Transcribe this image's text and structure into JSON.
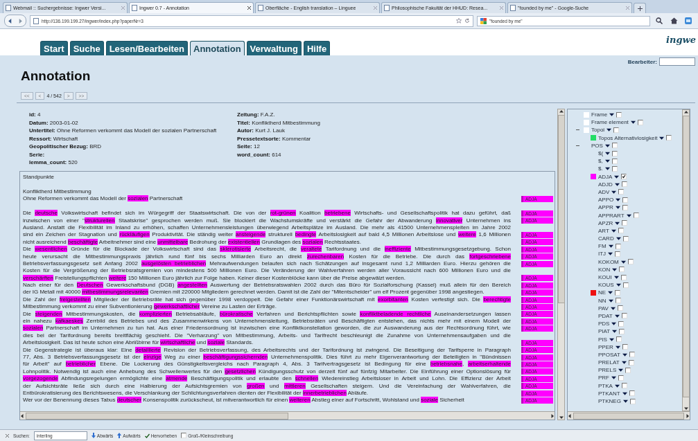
{
  "browser": {
    "tabs": [
      {
        "title": "Webmail :: Suchergebnisse: Ingwer Versi...",
        "selected": false
      },
      {
        "title": "Ingwer 0.7 - Annotation",
        "selected": true
      },
      {
        "title": "Oberfläche - English translation – Linguee",
        "selected": false
      },
      {
        "title": "Philosophische Fakultät der HHUD: Resea...",
        "selected": false
      },
      {
        "title": "\"founded by me\" - Google-Suche",
        "selected": false
      }
    ],
    "url": "http://136.199.199.27/ingwer/index.php?paperNr=3",
    "search": "\"founded by me\""
  },
  "app": {
    "tabs": [
      {
        "label": "Start",
        "selected": false
      },
      {
        "label": "Suche",
        "selected": false
      },
      {
        "label": "Lesen/Bearbeiten",
        "selected": false
      },
      {
        "label": "Annotation",
        "selected": true
      },
      {
        "label": "Verwaltung",
        "selected": false
      },
      {
        "label": "Hilfe",
        "selected": false
      }
    ],
    "logo": "ingwe",
    "editor_label": "Bearbeiter:"
  },
  "heading": "Annotation",
  "pager": {
    "prev_buttons": [
      "<<",
      "<"
    ],
    "position": "4 / 542",
    "next_buttons": [
      ">",
      ">>"
    ]
  },
  "metadata": {
    "left": [
      {
        "label": "id:",
        "value": "4"
      },
      {
        "label": "Datum:",
        "value": "2003-01-02"
      },
      {
        "label": "Untertitel:",
        "value": "Ohne Reformen verkommt das Modell der sozialen Partnerschaft"
      },
      {
        "label": "Ressort:",
        "value": "Wirtschaft"
      },
      {
        "label": "Geopolitischer Bezug:",
        "value": "BRD"
      },
      {
        "label": "Serie:"
      },
      {
        "label": "lemma_count:",
        "value": "520"
      }
    ],
    "right": [
      {
        "label": "Zeitung:",
        "value": "F.A.Z."
      },
      {
        "label": "Titel:",
        "value": "Konfliktherd Mitbestimmung"
      },
      {
        "label": "Autor:",
        "value": "Kurt J. Lauk"
      },
      {
        "label": "Pressetextsorte:",
        "value": "Kommentar"
      },
      {
        "label": "Seite:",
        "value": "12"
      },
      {
        "label": "word_count:",
        "value": "614"
      }
    ]
  },
  "document": {
    "blocks": [
      {
        "kind": "heading",
        "lines": [
          {
            "segments": [
              {
                "text": "Standpunkte",
                "highlighted": false
              }
            ]
          }
        ]
      },
      {
        "kind": "title",
        "lines": [
          {
            "segments": [
              {
                "text": "Konfliktherd Mitbestimmung",
                "highlighted": false
              }
            ]
          },
          {
            "segments": [
              {
                "text": "Ohne Reformen verkommt das Modell der ",
                "highlighted": false
              },
              {
                "text": "sozialen",
                "highlighted": true
              },
              {
                "text": " Partnerschaft",
                "highlighted": false
              }
            ],
            "tag": "ADJA"
          }
        ]
      },
      {
        "kind": "body",
        "lines": [
          {
            "segments": [
              {
                "text": "Die ",
                "highlighted": false
              },
              {
                "text": "deutsche",
                "highlighted": true
              },
              {
                "text": " Volkswirtschaft befindet sich im Würgegriff der Staatswirtschaft. Die von der ",
                "highlighted": false
              },
              {
                "text": "rot-grünen",
                "highlighted": true
              },
              {
                "text": " Koalition ",
                "highlighted": false
              },
              {
                "text": "betriebene",
                "highlighted": true
              },
              {
                "text": " Wirtschafts- und Gesellschaftspolitik hat dazu geführt, daß",
                "highlighted": false
              }
            ],
            "tag": "ADJA"
          },
          {
            "segments": [
              {
                "text": "inzwischen von einer \"",
                "highlighted": false
              },
              {
                "text": "strukturellen",
                "highlighted": true
              },
              {
                "text": " Staatskrise\" gesprochen werden muß. Sie blockiert die Wachstumskräfte und verstärkt die Gefahr der Abwanderung ",
                "highlighted": false
              },
              {
                "text": "innovativer",
                "highlighted": true
              },
              {
                "text": " Unternehmen ins",
                "highlighted": false
              }
            ],
            "tag": "ADJA"
          },
          {
            "segments": [
              {
                "text": "Ausland. Anstatt die Flexibilität im Inland zu erhöhen, schaffen Unternehmensleistungen überwiegend Arbeitsplätze im Ausland. Die mehr als 41500 Unternehmenspleiten im Jahre 2002",
                "highlighted": false
              }
            ]
          },
          {
            "segments": [
              {
                "text": "sind ein Zeichen der Stagnation und ",
                "highlighted": false
              },
              {
                "text": "rückläufigen",
                "highlighted": true
              },
              {
                "text": " Produktivität. Die ständig weiter ",
                "highlighted": false
              },
              {
                "text": "ansteigende",
                "highlighted": true
              },
              {
                "text": " strukturell ",
                "highlighted": false
              },
              {
                "text": "bedingte",
                "highlighted": true
              },
              {
                "text": " Arbeitslosigkeit auf bald 4,5 Millionen Arbeitslose und ",
                "highlighted": false
              },
              {
                "text": "weitere",
                "highlighted": true
              },
              {
                "text": " 1,6 Millionen",
                "highlighted": false
              }
            ],
            "tag": "ADJA"
          },
          {
            "segments": [
              {
                "text": "nicht ausreichend ",
                "highlighted": false
              },
              {
                "text": "beschäftigte",
                "highlighted": true
              },
              {
                "text": " Arbeitnehmer sind eine ",
                "highlighted": false
              },
              {
                "text": "unmittelbare",
                "highlighted": true
              },
              {
                "text": " Bedrohung der ",
                "highlighted": false
              },
              {
                "text": "existentiellen",
                "highlighted": true
              },
              {
                "text": " Grundlagen des ",
                "highlighted": false
              },
              {
                "text": "sozialen",
                "highlighted": true
              },
              {
                "text": " Rechtsstaates.",
                "highlighted": false
              }
            ],
            "tag": "ADJA"
          }
        ]
      },
      {
        "kind": "body",
        "lines": [
          {
            "segments": [
              {
                "text": "Die ",
                "highlighted": false
              },
              {
                "text": "wesentlichen",
                "highlighted": true
              },
              {
                "text": " Gründe für die Blockade der Volkswirtschaft sind das ",
                "highlighted": false
              },
              {
                "text": "sklerotisierte",
                "highlighted": true
              },
              {
                "text": " Arbeitsrecht, die ",
                "highlighted": false
              },
              {
                "text": "veraltete",
                "highlighted": true
              },
              {
                "text": " Tarifordnung und die ",
                "highlighted": false
              },
              {
                "text": "ineffiziente",
                "highlighted": true
              },
              {
                "text": " Mitbestimmungsgesetzgebung. Schon",
                "highlighted": false
              }
            ],
            "tag": "ADJA"
          },
          {
            "segments": [
              {
                "text": "heute verursacht die Mitbestimmungspraxis jährlich rund fünf bis sechs Milliarden Euro an direkt ",
                "highlighted": false
              },
              {
                "text": "zurechenbaren",
                "highlighted": true
              },
              {
                "text": " Kosten für die Betriebe. Die durch das ",
                "highlighted": false
              },
              {
                "text": "fortgeschriebene",
                "highlighted": true
              }
            ],
            "tag": "ADJA"
          },
          {
            "segments": [
              {
                "text": "Betriebsverfassungsgesetz seit Anfang 2002 ",
                "highlighted": false
              },
              {
                "text": "ausgelösten ",
                "highlighted": true
              },
              {
                "text": "betrieblichen",
                "highlighted": true
              },
              {
                "text": " Mehraufwendungen belaufen sich nach Schätzungen auf insgesamt rund 1,2 Milliarden Euro. Hierzu gehören die",
                "highlighted": false
              }
            ],
            "tag": "ADJA"
          },
          {
            "segments": [
              {
                "text": "Kosten für die Vergrößerung der Betriebsratsgremien von mindestens 500 Millionen Euro. Die Veränderung der Wahlverfahren werden aller Voraussicht nach 600 Millionen Euro und die",
                "highlighted": false
              }
            ]
          },
          {
            "segments": [
              {
                "text": "verschärften",
                "highlighted": true
              },
              {
                "text": " Freistellungspflichten ",
                "highlighted": false
              },
              {
                "text": "weitere",
                "highlighted": true
              },
              {
                "text": " 150 Millionen Euro jährlich zur Folge haben. Keiner dieser Kostenblöcke kann über die Preise abgewälzt werden.",
                "highlighted": false
              }
            ],
            "tag": "ADJA"
          }
        ]
      },
      {
        "kind": "body",
        "lines": [
          {
            "segments": [
              {
                "text": "Nach einer für den ",
                "highlighted": false
              },
              {
                "text": "Deutschen",
                "highlighted": true
              },
              {
                "text": " Gewerkschaftsbund (DGB) ",
                "highlighted": false
              },
              {
                "text": "angestellten",
                "highlighted": true
              },
              {
                "text": " Auswertung der Betriebsratswahlen 2002 durch das Büro für Sozialforschung (Kassel) muß allein für den Bereich",
                "highlighted": false
              }
            ],
            "tag": "ADJA"
          },
          {
            "segments": [
              {
                "text": "der IG Metall mit 40000 ",
                "highlighted": false
              },
              {
                "text": "mitbestimmungsrelevanten",
                "highlighted": true
              },
              {
                "text": " Gremien mit 220000 Mitgliedern gerechnet werden. Damit ist die Zahl der \"Mitentscheider\" um elf Prozent gegenüber 1998 angestiegen.",
                "highlighted": false
              }
            ],
            "tag": "ADJA"
          }
        ]
      },
      {
        "kind": "body",
        "lines": [
          {
            "segments": [
              {
                "text": "Die Zahl der ",
                "highlighted": false
              },
              {
                "text": "freigestellten",
                "highlighted": true
              },
              {
                "text": " Mitglieder der Betriebsräte hat sich gegenüber 1998 verdoppelt. Die Gefahr einer Funktionärswirtschaft mit ",
                "highlighted": false
              },
              {
                "text": "exorbitanten",
                "highlighted": true
              },
              {
                "text": " Kosten verfestigt sich. Die ",
                "highlighted": false
              },
              {
                "text": "berechtigte",
                "highlighted": true
              }
            ],
            "tag": "ADJA"
          },
          {
            "segments": [
              {
                "text": "Mitbestimmung verkommt zu einer Subventionierung ",
                "highlighted": false
              },
              {
                "text": "gewerkschaftlicher",
                "highlighted": true
              },
              {
                "text": " Vereine zu Lasten der Erträge.",
                "highlighted": false
              }
            ],
            "tag": "ADJA"
          }
        ]
      },
      {
        "kind": "body",
        "lines": [
          {
            "segments": [
              {
                "text": "Die ",
                "highlighted": false
              },
              {
                "text": "steigenden",
                "highlighted": true
              },
              {
                "text": " Mitbestimmungskosten, die ",
                "highlighted": false
              },
              {
                "text": "komplizierten",
                "highlighted": true
              },
              {
                "text": " Betriebsabläufe, ",
                "highlighted": false
              },
              {
                "text": "bürokratische",
                "highlighted": true
              },
              {
                "text": " Verfahren und Berichtspflichten sowie ",
                "highlighted": false
              },
              {
                "text": "konfliktbeladende ",
                "highlighted": true
              },
              {
                "text": "rechtliche",
                "highlighted": true
              },
              {
                "text": " Auseinandersetzungen lassen",
                "highlighted": false
              }
            ],
            "tag": "ADJA"
          },
          {
            "segments": [
              {
                "text": "ein nahezu ",
                "highlighted": false
              },
              {
                "text": "kafkaeskes",
                "highlighted": true
              },
              {
                "text": " Zerrbild des Betriebes und des Zusammenwirkens von Unternehmensleitung, Betriebsräten und Beschäftigten entstehen, das nichts mehr mit einem Modell der",
                "highlighted": false
              }
            ],
            "tag": "ADJA"
          },
          {
            "segments": [
              {
                "text": "sozialen",
                "highlighted": true
              },
              {
                "text": " Partnerschaft im Unternehmen zu tun hat. Aus einer Friedensordnung ist inzwischen eine Konfliktkonstellation geworden, die zur Auswanderung aus der Rechtsordnung führt, wie",
                "highlighted": false
              }
            ],
            "tag": "ADJA"
          },
          {
            "segments": [
              {
                "text": "dies bei der Tarifordnung bereits breitflächig geschieht. Die \"Verharzung\" von Mitbestimmung, Arbeits- und Tarifrecht beschleunigt die Zunahme von Unternehmensaufgaben und die",
                "highlighted": false
              }
            ]
          },
          {
            "segments": [
              {
                "text": "Arbeitslosigkeit. Das ist heute schon eine Abrißbirne für ",
                "highlighted": false
              },
              {
                "text": "wirtschaftliche",
                "highlighted": true
              },
              {
                "text": " und ",
                "highlighted": false
              },
              {
                "text": "soziale",
                "highlighted": true
              },
              {
                "text": " Standards.",
                "highlighted": false
              }
            ],
            "tag": "ADJA"
          }
        ]
      },
      {
        "kind": "body",
        "lines": [
          {
            "segments": [
              {
                "text": "Die Gegenstrategie ist überaus klar: Eine ",
                "highlighted": false
              },
              {
                "text": "detaillierte",
                "highlighted": true
              },
              {
                "text": " Revision der Betriebsverfassung, des Arbeitsrechts und der Tarifordnung ist zwingend. Die Beseitigung der Tarifsperre in Paragraph",
                "highlighted": false
              }
            ],
            "tag": "ADJA"
          },
          {
            "segments": [
              {
                "text": "77, Abs. 3 Betriebsverfassungsgesetz ist der ",
                "highlighted": false
              },
              {
                "text": "einzige",
                "highlighted": true
              },
              {
                "text": " Weg zu einer ",
                "highlighted": false
              },
              {
                "text": "beschäftigungssichernden",
                "highlighted": true
              },
              {
                "text": " Unternehmenspolitik. Dies führt zu mehr Eigenverantwortung der Beteiligten in \"Bündnissen",
                "highlighted": false
              }
            ],
            "tag": "ADJA"
          },
          {
            "segments": [
              {
                "text": "für Arbeit\" auf ",
                "highlighted": false
              },
              {
                "text": "betrieblicher",
                "highlighted": true
              },
              {
                "text": " Ebene. Die Lockerung des Günstigkeitsvergleichs nach Paragraph 4, Abs. 3 Tarifvertragsgesetz ist Bedingung für eine ",
                "highlighted": false
              },
              {
                "text": "betriebsnahe",
                "highlighted": true
              },
              {
                "text": ", ",
                "highlighted": false
              },
              {
                "text": "arbeitserhaltende",
                "highlighted": true
              }
            ],
            "tag": "ADJA"
          },
          {
            "segments": [
              {
                "text": "Lohnpolitik. Notwendig ist auch eine Anhebung des Schwellenwertes für den ",
                "highlighted": false
              },
              {
                "text": "gesetzlichen",
                "highlighted": true
              },
              {
                "text": " Kündigungsschutz von derzeit fünf auf fünfzig Mitarbeiter. Die Einführung einer Optionslösung für",
                "highlighted": false
              }
            ],
            "tag": "ADJA"
          },
          {
            "segments": [
              {
                "text": "vorgezogende",
                "highlighted": true
              },
              {
                "text": " Abfindungsregelungen ermöglichte eine ",
                "highlighted": false
              },
              {
                "text": "atmende",
                "highlighted": true
              },
              {
                "text": " Beschäftigungspolitik und erlaubte den ",
                "highlighted": false
              },
              {
                "text": "schnellen",
                "highlighted": true
              },
              {
                "text": " Wiedereinstieg Arbeitsloser in Arbeit und Lohn. Die Effizienz der Arbeit",
                "highlighted": false
              }
            ],
            "tag": "ADJA"
          },
          {
            "segments": [
              {
                "text": "der Aufsichtsräte ließe sich durch eine Halbierung der Aufsichtsgremien von ",
                "highlighted": false
              },
              {
                "text": "großen",
                "highlighted": true
              },
              {
                "text": " und ",
                "highlighted": false
              },
              {
                "text": "mittleren",
                "highlighted": true
              },
              {
                "text": " Gesellschaften steigern. Und die Vereinfachung der Wahlverfahren, die",
                "highlighted": false
              }
            ],
            "tag": "ADJA"
          },
          {
            "segments": [
              {
                "text": "Entbürokratisierung des Berichtswesens, die Verschlankung der Schlichtungsverfahren dienten der Flexibilität der ",
                "highlighted": false
              },
              {
                "text": "innerbetrieblichen",
                "highlighted": true
              },
              {
                "text": " Abläufe.",
                "highlighted": false
              }
            ],
            "tag": "ADJA"
          }
        ]
      },
      {
        "kind": "body",
        "lines": [
          {
            "segments": [
              {
                "text": "Wer vor der Benennung dieses Tabus ",
                "highlighted": false
              },
              {
                "text": "deutscher",
                "highlighted": true
              },
              {
                "text": " Konsenspolitik zurückscheut, ist mitverantwortlich für einen ",
                "highlighted": false
              },
              {
                "text": "weiteren",
                "highlighted": true
              },
              {
                "text": " Abstieg einer auf Fortschritt, Wohlstand und ",
                "highlighted": false
              },
              {
                "text": "soziale",
                "highlighted": true
              },
              {
                "text": " Sicherheit",
                "highlighted": false
              }
            ],
            "tag": "ADJA"
          }
        ]
      }
    ]
  },
  "sidebar": {
    "items": [
      {
        "label": "Frame",
        "color": "#ffffff",
        "checked": false
      },
      {
        "label": "Frame element",
        "color": "#ffffff",
        "checked": false
      },
      {
        "label": "Topoi",
        "color": "#ffffff",
        "checked": false,
        "expanded": true,
        "children": [
          {
            "label": "Topos Alternativlosigkeit",
            "color": "#22dd66",
            "checked": false
          }
        ]
      },
      {
        "label": "POS",
        "checked": false,
        "expanded": true,
        "children": [
          {
            "label": "$(",
            "checked": false
          },
          {
            "label": "$,",
            "checked": false
          },
          {
            "label": "$.",
            "checked": false
          },
          {
            "label": "ADJA",
            "color": "#ff00ff",
            "checked": true
          },
          {
            "label": "ADJD",
            "checked": false
          },
          {
            "label": "ADV",
            "checked": false
          },
          {
            "label": "APPO",
            "checked": false
          },
          {
            "label": "APPR",
            "checked": false
          },
          {
            "label": "APPRART",
            "checked": false
          },
          {
            "label": "APZR",
            "checked": false
          },
          {
            "label": "ART",
            "checked": false
          },
          {
            "label": "CARD",
            "checked": false
          },
          {
            "label": "FM",
            "checked": false
          },
          {
            "label": "ITJ",
            "checked": false
          },
          {
            "label": "KOKOM",
            "checked": false
          },
          {
            "label": "KON",
            "checked": false
          },
          {
            "label": "KOUI",
            "checked": false
          },
          {
            "label": "KOUS",
            "checked": false
          },
          {
            "label": "NE",
            "color": "#ee1111",
            "checked": false
          },
          {
            "label": "NN",
            "checked": false
          },
          {
            "label": "PAV",
            "checked": false
          },
          {
            "label": "PDAT",
            "checked": false
          },
          {
            "label": "PDS",
            "checked": false
          },
          {
            "label": "PIAT",
            "checked": false
          },
          {
            "label": "PIS",
            "checked": false
          },
          {
            "label": "PPER",
            "checked": false
          },
          {
            "label": "PPOSAT",
            "checked": false
          },
          {
            "label": "PRELAT",
            "checked": false
          },
          {
            "label": "PRELS",
            "checked": false
          },
          {
            "label": "PRF",
            "checked": false
          },
          {
            "label": "PTKA",
            "checked": false
          },
          {
            "label": "PTKANT",
            "checked": false
          },
          {
            "label": "PTKNEG",
            "checked": false
          }
        ]
      }
    ]
  },
  "find_bar": {
    "label": "Suchen:",
    "value": "interling",
    "buttons": [
      {
        "label": "Abwärts",
        "kind": "down"
      },
      {
        "label": "Aufwärts",
        "kind": "up"
      }
    ],
    "highlight": {
      "label": "Hervorheben",
      "checked": true
    },
    "match_case": {
      "label": "Groß-/Kleinschreibung",
      "checked": false
    }
  }
}
